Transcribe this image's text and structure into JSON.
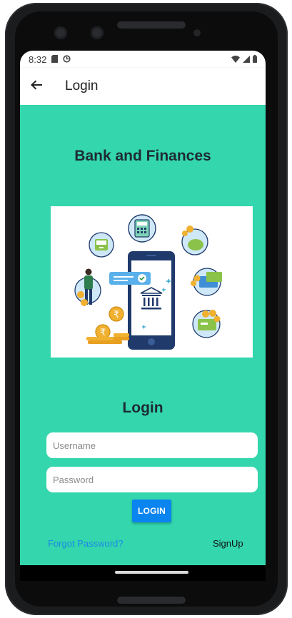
{
  "status_bar": {
    "time": "8:32",
    "icons_left": [
      "sd-card-icon",
      "sync-icon"
    ],
    "icons_right": [
      "wifi-icon",
      "signal-icon",
      "battery-icon"
    ]
  },
  "appbar": {
    "back_icon": "arrow-left-icon",
    "title": "Login"
  },
  "main": {
    "app_title": "Bank and Finances",
    "illustration": "mobile-banking-illustration",
    "form_title": "Login",
    "username_placeholder": "Username",
    "username_value": "",
    "password_placeholder": "Password",
    "password_value": "",
    "login_button": "LOGIN",
    "forgot_password": "Forgot Password?",
    "signup": "SignUp"
  },
  "colors": {
    "background": "#33d6ad",
    "button": "#0a84ef",
    "forgot_link": "#1e88e5",
    "heading": "#1e2b33"
  }
}
